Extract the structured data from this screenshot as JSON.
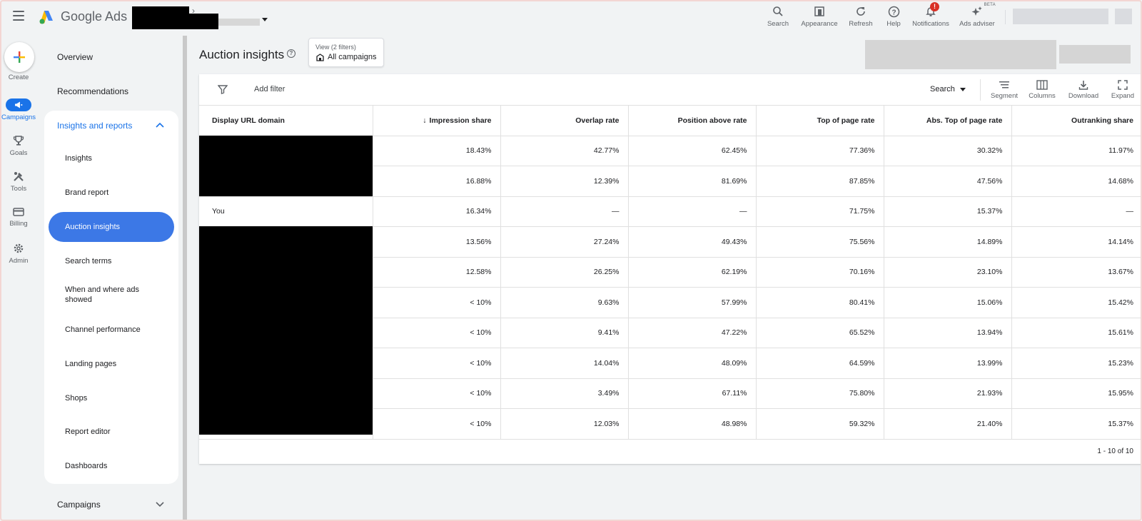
{
  "app": {
    "title": "Google Ads"
  },
  "toolbar": [
    {
      "label": "Search",
      "icon": "search-icon"
    },
    {
      "label": "Appearance",
      "icon": "appearance-icon"
    },
    {
      "label": "Refresh",
      "icon": "refresh-icon"
    },
    {
      "label": "Help",
      "icon": "help-icon"
    },
    {
      "label": "Notifications",
      "icon": "bell-icon",
      "badge": "!"
    },
    {
      "label": "Ads adviser",
      "icon": "sparkle-icon",
      "tag": "BETA"
    }
  ],
  "rail": {
    "create": "Create",
    "items": [
      {
        "label": "Campaigns",
        "icon": "megaphone-icon",
        "active": true
      },
      {
        "label": "Goals",
        "icon": "trophy-icon"
      },
      {
        "label": "Tools",
        "icon": "tools-icon"
      },
      {
        "label": "Billing",
        "icon": "card-icon"
      },
      {
        "label": "Admin",
        "icon": "gear-icon"
      }
    ]
  },
  "nav": {
    "overview": "Overview",
    "recommendations": "Recommendations",
    "group_label": "Insights and reports",
    "sub_items": [
      "Insights",
      "Brand report",
      "Auction insights",
      "Search terms",
      "When and where ads showed",
      "Channel performance",
      "Landing pages",
      "Shops",
      "Report editor",
      "Dashboards"
    ],
    "active": "Auction insights",
    "campaigns": "Campaigns"
  },
  "page": {
    "title": "Auction insights",
    "view_label": "View (2 filters)",
    "view_value": "All campaigns"
  },
  "filterbar": {
    "add_filter": "Add filter",
    "segment_value": "Search",
    "tools": [
      "Segment",
      "Columns",
      "Download",
      "Expand"
    ]
  },
  "table": {
    "columns": [
      "Display URL domain",
      "Impression share",
      "Overlap rate",
      "Position above rate",
      "Top of page rate",
      "Abs. Top of page rate",
      "Outranking share"
    ],
    "sorted_column": "Impression share",
    "rows": [
      {
        "domain": "",
        "redacted": true,
        "cells": [
          "18.43%",
          "42.77%",
          "62.45%",
          "77.36%",
          "30.32%",
          "11.97%"
        ]
      },
      {
        "domain": "",
        "redacted": true,
        "cells": [
          "16.88%",
          "12.39%",
          "81.69%",
          "87.85%",
          "47.56%",
          "14.68%"
        ]
      },
      {
        "domain": "You",
        "redacted": false,
        "cells": [
          "16.34%",
          "—",
          "—",
          "71.75%",
          "15.37%",
          "—"
        ]
      },
      {
        "domain": "",
        "redacted": true,
        "cells": [
          "13.56%",
          "27.24%",
          "49.43%",
          "75.56%",
          "14.89%",
          "14.14%"
        ]
      },
      {
        "domain": "",
        "redacted": true,
        "cells": [
          "12.58%",
          "26.25%",
          "62.19%",
          "70.16%",
          "23.10%",
          "13.67%"
        ]
      },
      {
        "domain": "",
        "redacted": true,
        "cells": [
          "< 10%",
          "9.63%",
          "57.99%",
          "80.41%",
          "15.06%",
          "15.42%"
        ]
      },
      {
        "domain": "",
        "redacted": true,
        "cells": [
          "< 10%",
          "9.41%",
          "47.22%",
          "65.52%",
          "13.94%",
          "15.61%"
        ]
      },
      {
        "domain": "",
        "redacted": true,
        "cells": [
          "< 10%",
          "14.04%",
          "48.09%",
          "64.59%",
          "13.99%",
          "15.23%"
        ]
      },
      {
        "domain": "",
        "redacted": true,
        "cells": [
          "< 10%",
          "3.49%",
          "67.11%",
          "75.80%",
          "21.93%",
          "15.95%"
        ]
      },
      {
        "domain": "",
        "redacted": true,
        "cells": [
          "< 10%",
          "12.03%",
          "48.98%",
          "59.32%",
          "21.40%",
          "15.37%"
        ]
      }
    ],
    "pagination": "1 - 10 of 10"
  },
  "colors": {
    "accent": "#1a73e8",
    "active_nav": "#3c78e6",
    "badge": "#d93025"
  }
}
